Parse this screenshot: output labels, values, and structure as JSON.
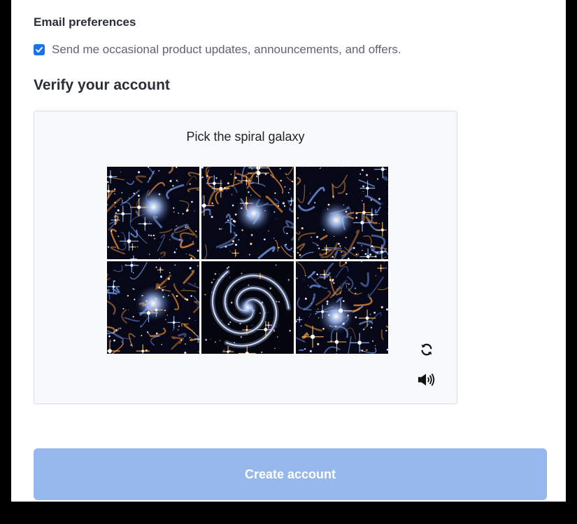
{
  "email_preferences": {
    "label": "Email preferences",
    "opt_in_text": "Send me occasional product updates, announcements, and offers.",
    "opt_in_checked": true
  },
  "verify": {
    "heading": "Verify your account",
    "prompt": "Pick the spiral galaxy",
    "tiles": [
      {
        "content": "starfield"
      },
      {
        "content": "starfield"
      },
      {
        "content": "starfield",
        "selected": true
      },
      {
        "content": "starfield"
      },
      {
        "content": "spiral-galaxy"
      },
      {
        "content": "starfield"
      }
    ],
    "refresh_icon": "refresh-icon",
    "audio_icon": "audio-icon"
  },
  "submit": {
    "label": "Create account",
    "color": "#97b8ec"
  },
  "colors": {
    "accent": "#1a73e8",
    "frame": "#000000"
  }
}
